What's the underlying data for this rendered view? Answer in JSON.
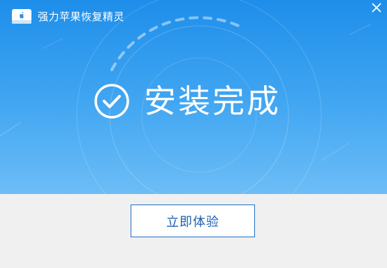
{
  "window": {
    "title": "强力苹果恢复精灵",
    "close_icon": "close-icon",
    "app_icon": "apple-drive-icon"
  },
  "status": {
    "icon": "check-circle-icon",
    "text": "安装完成"
  },
  "footer": {
    "action_label": "立即体验"
  },
  "colors": {
    "hero_top": "#1e8eea",
    "hero_bottom": "#6dbdf6",
    "footer_bg": "#f0f0f0",
    "button_border": "#1f6fc4",
    "button_text": "#1f5fae"
  }
}
